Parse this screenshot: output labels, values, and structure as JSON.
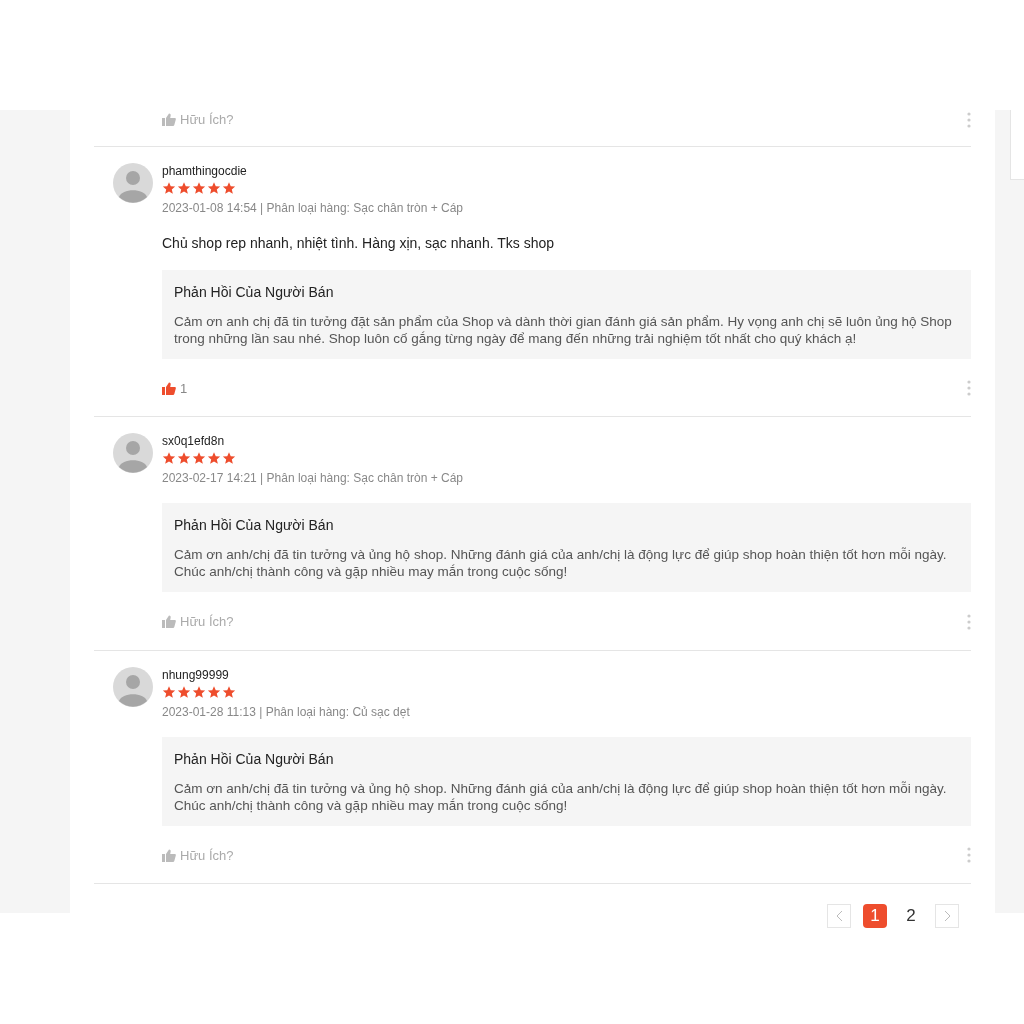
{
  "top_helpful": {
    "liked": false,
    "text": "Hữu Ích?"
  },
  "reviews": [
    {
      "user": "phamthingocdie",
      "stars": 5,
      "meta": "2023-01-08 14:54 | Phân loại hàng: Sạc chân tròn + Cáp",
      "comment": "Chủ shop rep nhanh, nhiệt tình. Hàng xịn, sạc nhanh. Tks shop",
      "reply_title": "Phản Hồi Của Người Bán",
      "reply": "Cảm ơn anh chị đã tin tưởng đặt sản phẩm của Shop và dành thời gian đánh giá sản phẩm. Hy vọng anh chị sẽ luôn ủng hộ Shop trong những lần sau nhé. Shop luôn cố gắng từng ngày để mang đến những trải nghiệm tốt nhất cho quý khách ạ!",
      "helpful": {
        "liked": true,
        "text": "1"
      }
    },
    {
      "user": "sx0q1efd8n",
      "stars": 5,
      "meta": "2023-02-17 14:21 | Phân loại hàng: Sạc chân tròn + Cáp",
      "reply_title": "Phản Hồi Của Người Bán",
      "reply": "Cảm ơn anh/chị đã tin tưởng và ủng hộ shop. Những đánh giá của anh/chị là động lực để giúp shop hoàn thiện tốt hơn mỗi ngày. Chúc anh/chị thành công và gặp nhiều may mắn trong cuộc sống!",
      "helpful": {
        "liked": false,
        "text": "Hữu Ích?"
      }
    },
    {
      "user": "nhung99999",
      "stars": 5,
      "meta": "2023-01-28 11:13 | Phân loại hàng: Củ sạc dẹt",
      "reply_title": "Phản Hồi Của Người Bán",
      "reply": "Cảm ơn anh/chị đã tin tưởng và ủng hộ shop. Những đánh giá của anh/chị là động lực để giúp shop hoàn thiện tốt hơn mỗi ngày. Chúc anh/chị thành công và gặp nhiều may mắn trong cuộc sống!",
      "helpful": {
        "liked": false,
        "text": "Hữu Ích?"
      }
    }
  ],
  "pagination": [
    {
      "label": "1",
      "selected": true
    },
    {
      "label": "2",
      "selected": false
    }
  ]
}
